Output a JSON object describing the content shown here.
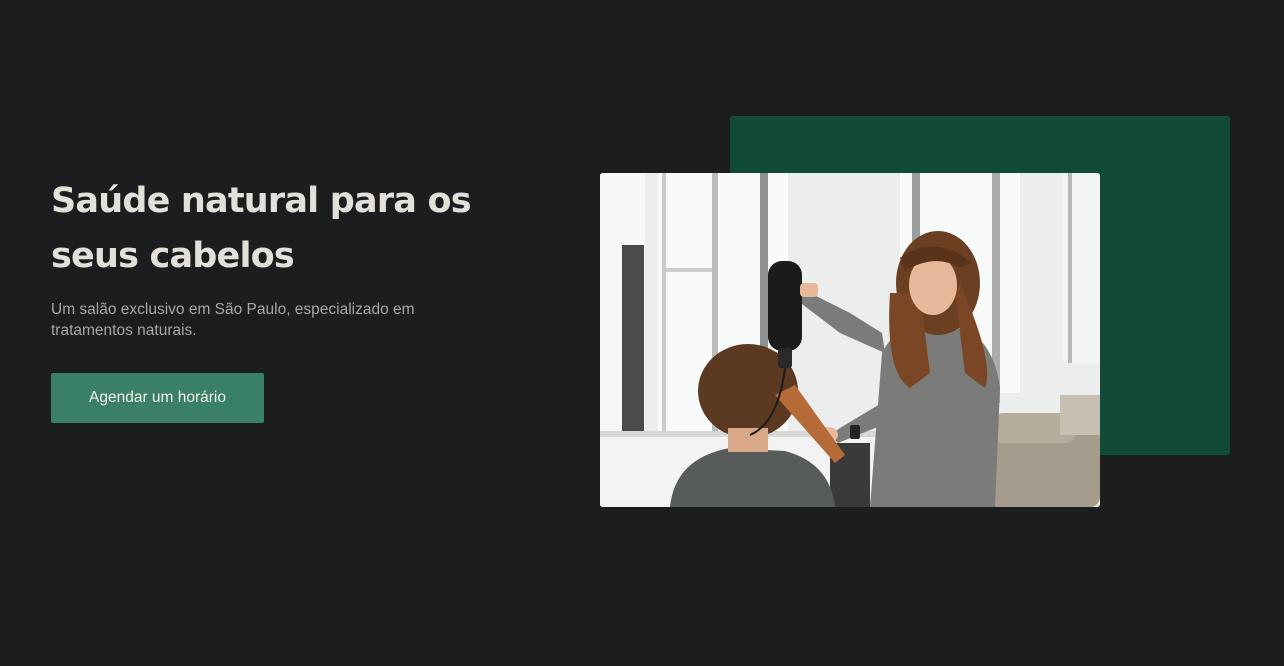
{
  "hero": {
    "title": "Saúde natural para os seus cabelos",
    "subtitle": "Um salão exclusivo em São Paulo, especializado em tratamentos naturais.",
    "cta_label": "Agendar um horário"
  },
  "colors": {
    "background": "#1c1d1f",
    "title": "#e3e0da",
    "subtitle": "#a8a6a1",
    "button": "#3a7f67",
    "accent_block": "#114a39"
  },
  "image": {
    "subject": "hairdresser blow-drying a client's hair in a bright salon"
  }
}
